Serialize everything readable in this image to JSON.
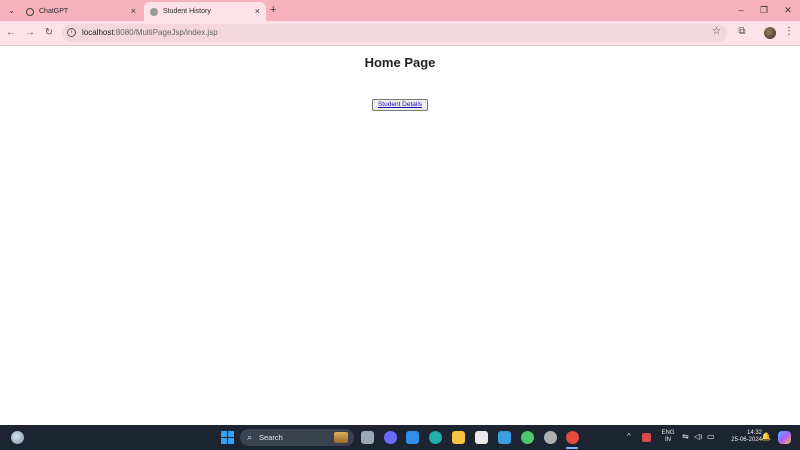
{
  "browser": {
    "tabs": [
      {
        "title": "ChatGPT",
        "active": false,
        "close_glyph": "×"
      },
      {
        "title": "Student History",
        "active": true,
        "close_glyph": "×"
      }
    ],
    "new_tab_glyph": "+",
    "window_controls": {
      "minimize": "–",
      "restore": "❐",
      "close": "✕"
    },
    "toolbar": {
      "back_glyph": "←",
      "forward_glyph": "→",
      "reload_glyph": "↻",
      "url_host": "localhost",
      "url_rest": ":8080/MultiPageJsp/index.jsp",
      "star_glyph": "☆",
      "menu_glyph": "⋮"
    }
  },
  "page": {
    "heading": "Home Page",
    "button_label": "Student Details"
  },
  "taskbar": {
    "search_label": "Search",
    "language_line1": "ENG",
    "language_line2": "IN",
    "time": "14:32",
    "date": "25-06-2024",
    "apps": [
      {
        "name": "task-view",
        "color": "#9aa8b8"
      },
      {
        "name": "copilot-chat",
        "color": "#6b6bff"
      },
      {
        "name": "vscode",
        "color": "#2f8fe8"
      },
      {
        "name": "edge",
        "color": "#1fb0a8"
      },
      {
        "name": "file-explorer",
        "color": "#f5c542"
      },
      {
        "name": "store",
        "color": "#e9e9e9"
      },
      {
        "name": "whiteboard",
        "color": "#3a9fe0"
      },
      {
        "name": "app-colorful",
        "color": "#4ec86a"
      },
      {
        "name": "settings",
        "color": "#b0b0b0"
      },
      {
        "name": "chrome",
        "color": "#e44b3c"
      }
    ]
  }
}
